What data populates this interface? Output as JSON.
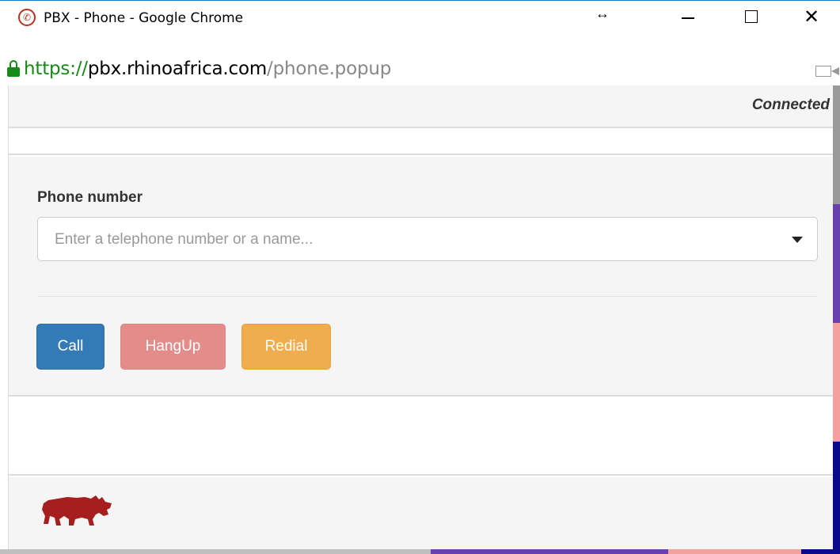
{
  "window": {
    "title": "PBX - Phone - Google Chrome",
    "app_icon": "phone-icon",
    "controls": [
      "minimize",
      "maximize",
      "close"
    ]
  },
  "address": {
    "scheme": "https://",
    "host": "pbx.rhinoafrica.com",
    "path": "/phone.popup"
  },
  "status": {
    "text": "Connected"
  },
  "form": {
    "phone_label": "Phone number",
    "phone_placeholder": "Enter a telephone number or a name...",
    "phone_value": ""
  },
  "buttons": {
    "call": "Call",
    "hangup": "HangUp",
    "redial": "Redial"
  },
  "footer": {
    "logo": "rhino-logo"
  },
  "colors": {
    "call": "#337ab7",
    "hangup": "#e48c8a",
    "redial": "#f0ad4e",
    "logo": "#a61e1e",
    "secure_url": "#168a17"
  }
}
